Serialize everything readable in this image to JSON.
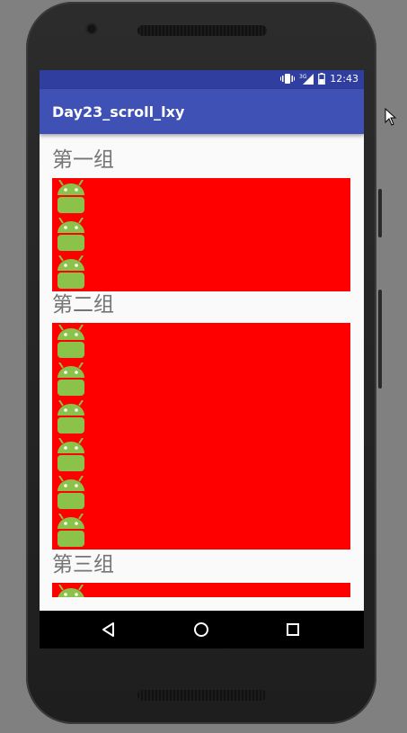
{
  "status_bar": {
    "time": "12:43"
  },
  "app_bar": {
    "title": "Day23_scroll_lxy"
  },
  "groups": [
    {
      "title": "第一组",
      "item_count": 3
    },
    {
      "title": "第二组",
      "item_count": 6
    },
    {
      "title": "第三组",
      "item_count": 1
    }
  ],
  "colors": {
    "status_bar": "#303f9f",
    "app_bar": "#3f51b5",
    "group_background": "#ff0000",
    "group_title": "#757575",
    "android_icon": "#8bc34a"
  },
  "icons": [
    "vibrate-icon",
    "signal-3g-icon",
    "battery-icon",
    "android-icon",
    "back-icon",
    "home-icon",
    "recents-icon"
  ]
}
